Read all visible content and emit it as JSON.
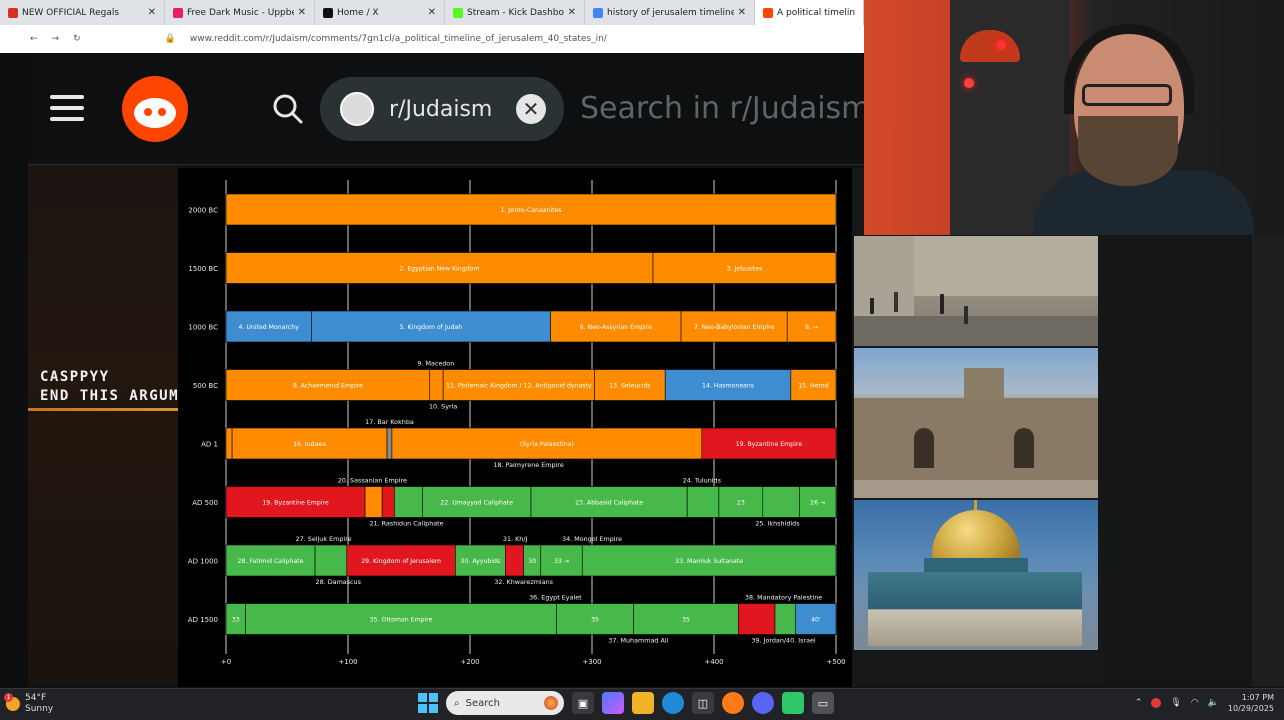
{
  "browser": {
    "tabs": [
      {
        "label": "NEW OFFICIAL Regals",
        "fav": "#d93025",
        "active": false
      },
      {
        "label": "Free Dark Music - Uppbeat",
        "fav": "#e91e63",
        "active": false
      },
      {
        "label": "Home / X",
        "fav": "#111111",
        "active": false
      },
      {
        "label": "Stream - Kick Dashboard",
        "fav": "#53fc18",
        "active": false
      },
      {
        "label": "history of jerusalem timeline - G",
        "fav": "#4285f4",
        "active": false
      },
      {
        "label": "A political timeline",
        "fav": "#ff4500",
        "active": true
      }
    ],
    "url": "www.reddit.com/r/Judaism/comments/7gn1cl/a_political_timeline_of_jerusalem_40_states_in/"
  },
  "reddit": {
    "subreddit": "r/Judaism",
    "search_placeholder": "Search in r/Judaism",
    "clear_symbol": "✕"
  },
  "overlay": {
    "line1": "CASPPYY",
    "line2": "END THIS ARGUMENT"
  },
  "chart_data": {
    "type": "timeline",
    "x_ticks": [
      "+0",
      "+100",
      "+200",
      "+300",
      "+400",
      "+500"
    ],
    "x_range": [
      0,
      500
    ],
    "colors": {
      "orange": "#ff8c00",
      "blue": "#3d8dd0",
      "red": "#e2161e",
      "green": "#47b84a",
      "gray": "#8c8c8c"
    },
    "rows": [
      {
        "label": "2000 BC",
        "bars": [
          {
            "from": 0,
            "to": 500,
            "color": "orange",
            "text": "1. proto-Canaanites"
          }
        ]
      },
      {
        "label": "1500 BC",
        "bars": [
          {
            "from": 0,
            "to": 350,
            "color": "orange",
            "text": "2. Egyptian New Kingdom"
          },
          {
            "from": 350,
            "to": 500,
            "color": "orange",
            "text": "3. Jebusites"
          }
        ]
      },
      {
        "label": "1000 BC",
        "bars": [
          {
            "from": 0,
            "to": 70,
            "color": "blue",
            "text": "4. United Monarchy"
          },
          {
            "from": 70,
            "to": 266,
            "color": "blue",
            "text": "5. Kingdom of Judah"
          },
          {
            "from": 266,
            "to": 373,
            "color": "orange",
            "text": "6. Neo-Assyrian Empire"
          },
          {
            "from": 373,
            "to": 460,
            "color": "orange",
            "text": "7. Neo-Babylonian Empire"
          },
          {
            "from": 460,
            "to": 500,
            "color": "orange",
            "text": "8. →"
          }
        ]
      },
      {
        "label": "500 BC",
        "bars": [
          {
            "from": 0,
            "to": 167,
            "color": "orange",
            "text": "8. Achaemenid Empire"
          },
          {
            "from": 167,
            "to": 178,
            "color": "orange",
            "text": ""
          },
          {
            "from": 178,
            "to": 302,
            "color": "orange",
            "text": "11. Ptolemaic Kingdom / 12. Antigonid dynasty"
          },
          {
            "from": 302,
            "to": 360,
            "color": "orange",
            "text": "13. Seleucids"
          },
          {
            "from": 360,
            "to": 463,
            "color": "blue",
            "text": "14. Hasmoneans"
          },
          {
            "from": 463,
            "to": 500,
            "color": "orange",
            "text": "15. Herod"
          }
        ]
      },
      {
        "label": "AD 1",
        "bars": [
          {
            "from": 0,
            "to": 5,
            "color": "orange",
            "text": ""
          },
          {
            "from": 5,
            "to": 132,
            "color": "orange",
            "text": "16. Iudaea"
          },
          {
            "from": 132,
            "to": 136,
            "color": "gray",
            "text": ""
          },
          {
            "from": 136,
            "to": 390,
            "color": "orange",
            "text": "(Syria Palaestina)"
          },
          {
            "from": 390,
            "to": 500,
            "color": "red",
            "text": "19. Byzantine Empire"
          }
        ]
      },
      {
        "label": "AD 500",
        "bars": [
          {
            "from": 0,
            "to": 114,
            "color": "red",
            "text": "19. Byzantine Empire"
          },
          {
            "from": 114,
            "to": 128,
            "color": "orange",
            "text": ""
          },
          {
            "from": 128,
            "to": 138,
            "color": "red",
            "text": ""
          },
          {
            "from": 138,
            "to": 161,
            "color": "green",
            "text": ""
          },
          {
            "from": 161,
            "to": 250,
            "color": "green",
            "text": "22. Umayyad Caliphate"
          },
          {
            "from": 250,
            "to": 378,
            "color": "green",
            "text": "23. Abbasid Caliphate"
          },
          {
            "from": 378,
            "to": 404,
            "color": "green",
            "text": ""
          },
          {
            "from": 404,
            "to": 440,
            "color": "green",
            "text": "23"
          },
          {
            "from": 440,
            "to": 470,
            "color": "green",
            "text": ""
          },
          {
            "from": 470,
            "to": 500,
            "color": "green",
            "text": "26 →"
          }
        ]
      },
      {
        "label": "AD 1000",
        "bars": [
          {
            "from": 0,
            "to": 73,
            "color": "green",
            "text": "28. Fatimid Caliphate"
          },
          {
            "from": 73,
            "to": 99,
            "color": "green",
            "text": ""
          },
          {
            "from": 99,
            "to": 188,
            "color": "red",
            "text": "29. Kingdom of Jerusalem"
          },
          {
            "from": 188,
            "to": 229,
            "color": "green",
            "text": "30. Ayyubids"
          },
          {
            "from": 229,
            "to": 244,
            "color": "red",
            "text": ""
          },
          {
            "from": 244,
            "to": 258,
            "color": "green",
            "text": "30"
          },
          {
            "from": 258,
            "to": 292,
            "color": "green",
            "text": "33 →"
          },
          {
            "from": 292,
            "to": 500,
            "color": "green",
            "text": "33. Mamluk Sultanate"
          }
        ]
      },
      {
        "label": "AD 1500",
        "bars": [
          {
            "from": 0,
            "to": 16,
            "color": "green",
            "text": "33"
          },
          {
            "from": 16,
            "to": 271,
            "color": "green",
            "text": "35. Ottoman Empire"
          },
          {
            "from": 271,
            "to": 334,
            "color": "green",
            "text": "35"
          },
          {
            "from": 334,
            "to": 420,
            "color": "green",
            "text": "35"
          },
          {
            "from": 420,
            "to": 450,
            "color": "red",
            "text": ""
          },
          {
            "from": 450,
            "to": 467,
            "color": "green",
            "text": ""
          },
          {
            "from": 467,
            "to": 500,
            "color": "blue",
            "text": "40'"
          }
        ]
      }
    ],
    "annotations": [
      {
        "row": 3,
        "pos": "above",
        "x": 172,
        "text": "9. Macedon"
      },
      {
        "row": 3,
        "pos": "below",
        "x": 178,
        "text": "10. Syria"
      },
      {
        "row": 4,
        "pos": "above",
        "x": 134,
        "text": "17. Bar Kokhba"
      },
      {
        "row": 4,
        "pos": "below",
        "x": 248,
        "text": "18. Palmyrene Empire"
      },
      {
        "row": 5,
        "pos": "above",
        "x": 120,
        "text": "20. Sassanian Empire"
      },
      {
        "row": 5,
        "pos": "above",
        "x": 390,
        "text": "24. Tulunids"
      },
      {
        "row": 5,
        "pos": "below",
        "x": 148,
        "text": "21. Rashidun Caliphate"
      },
      {
        "row": 5,
        "pos": "below",
        "x": 452,
        "text": "25. Ikhshidids"
      },
      {
        "row": 6,
        "pos": "above",
        "x": 80,
        "text": "27. Seljuk Empire"
      },
      {
        "row": 6,
        "pos": "above",
        "x": 237,
        "text": "31. Kh/J"
      },
      {
        "row": 6,
        "pos": "above",
        "x": 300,
        "text": "34. Mongol Empire"
      },
      {
        "row": 6,
        "pos": "below",
        "x": 92,
        "text": "28. Damascus"
      },
      {
        "row": 6,
        "pos": "below",
        "x": 244,
        "text": "32. Khwarezmians"
      },
      {
        "row": 7,
        "pos": "above",
        "x": 270,
        "text": "36. Egypt Eyalet"
      },
      {
        "row": 7,
        "pos": "above",
        "x": 457,
        "text": "38. Mandatory Palestine"
      },
      {
        "row": 7,
        "pos": "below",
        "x": 338,
        "text": "37. Muhammad Ali"
      },
      {
        "row": 7,
        "pos": "below",
        "x": 457,
        "text": "39. Jordan/40. Israel"
      }
    ]
  },
  "taskbar": {
    "temp": "54°F",
    "weather": "Sunny",
    "weather_badge": "1",
    "search_label": "Search",
    "time": "1:07 PM",
    "date": "10/29/2025"
  }
}
